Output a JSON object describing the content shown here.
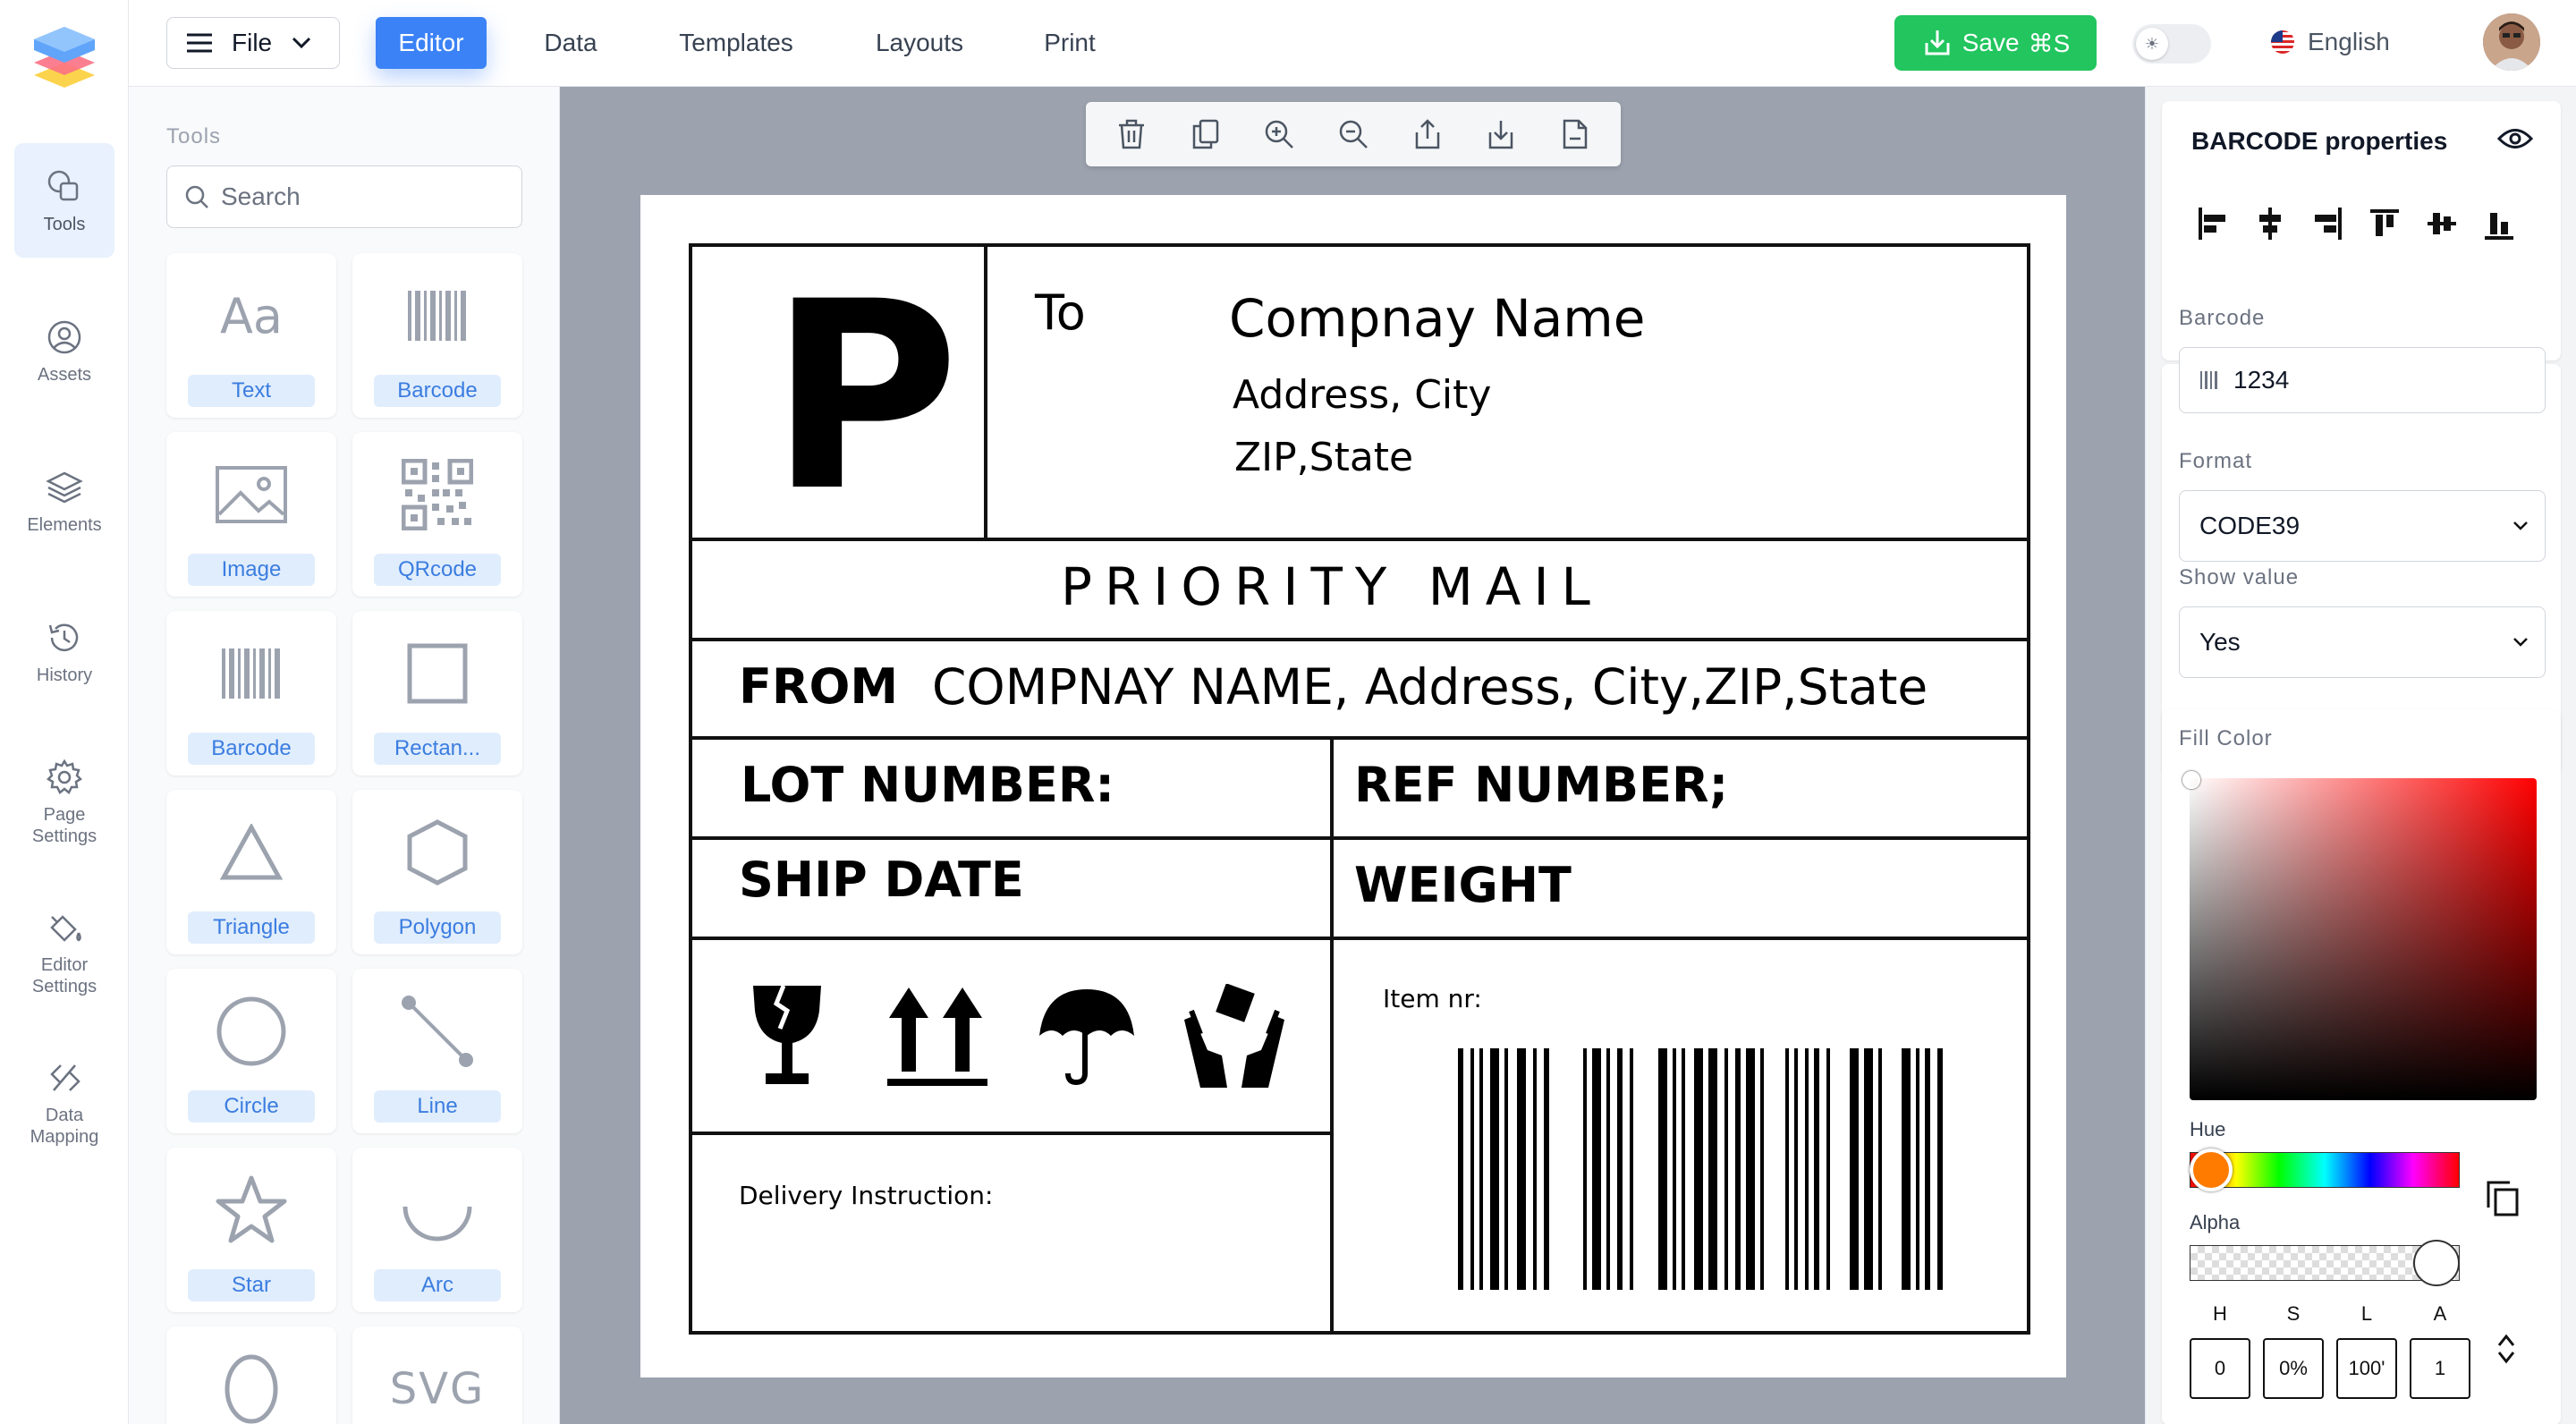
{
  "nav": {
    "items": [
      {
        "label": "Tools",
        "icon": "shapes-icon"
      },
      {
        "label": "Assets",
        "icon": "assets-icon"
      },
      {
        "label": "Elements",
        "icon": "layers-icon"
      },
      {
        "label": "History",
        "icon": "history-icon"
      },
      {
        "label": "Page Settings",
        "icon": "gear-icon"
      },
      {
        "label": "Editor Settings",
        "icon": "paint-bucket-icon"
      },
      {
        "label": "Data Mapping",
        "icon": "mapping-icon"
      }
    ]
  },
  "topbar": {
    "file_label": "File",
    "menu": [
      "Editor",
      "Data",
      "Templates",
      "Layouts",
      "Print"
    ],
    "active_menu": "Editor",
    "save_label": "Save",
    "save_shortcut": "⌘S",
    "language": "English",
    "colors": {
      "accent": "#3b82f6",
      "save": "#22c55e"
    }
  },
  "tools": {
    "title": "Tools",
    "search_placeholder": "Search",
    "items": [
      {
        "label": "Text",
        "icon": "text-icon"
      },
      {
        "label": "Barcode",
        "icon": "barcode-icon"
      },
      {
        "label": "Image",
        "icon": "image-icon"
      },
      {
        "label": "QRcode",
        "icon": "qrcode-icon"
      },
      {
        "label": "Barcode",
        "icon": "barcode-icon"
      },
      {
        "label": "Rectan...",
        "icon": "rectangle-icon"
      },
      {
        "label": "Triangle",
        "icon": "triangle-icon"
      },
      {
        "label": "Polygon",
        "icon": "hexagon-icon"
      },
      {
        "label": "Circle",
        "icon": "circle-icon"
      },
      {
        "label": "Line",
        "icon": "line-icon"
      },
      {
        "label": "Star",
        "icon": "star-icon"
      },
      {
        "label": "Arc",
        "icon": "arc-icon"
      },
      {
        "label": "",
        "icon": "ellipse-icon"
      },
      {
        "label": "",
        "icon": "svg-icon",
        "glyph": "SVG"
      }
    ]
  },
  "canvas_toolbar": [
    "trash-icon",
    "copy-icon",
    "zoom-in-icon",
    "zoom-out-icon",
    "upload-icon",
    "download-icon",
    "file-icon"
  ],
  "label": {
    "big_letter": "P",
    "to_label": "To",
    "company_name": "Compnay Name",
    "address_line": "Address, City",
    "zip_line": "ZIP,State",
    "priority": "PRIORITY MAIL",
    "from_label": "FROM",
    "from_value": "COMPNAY NAME, Address, City,ZIP,State",
    "lot_number": "LOT NUMBER:",
    "ref_number": "REF NUMBER;",
    "ship_date": "SHIP DATE",
    "weight": "WEIGHT",
    "item_nr": "Item nr:",
    "delivery_instruction": "Delivery Instruction:",
    "handling_icons": [
      "fragile-icon",
      "this-way-up-icon",
      "keep-dry-icon",
      "handle-with-care-icon"
    ]
  },
  "properties": {
    "title": "BARCODE properties",
    "barcode_label": "Barcode",
    "barcode_value": "1234",
    "format_label": "Format",
    "format_value": "CODE39",
    "show_value_label": "Show value",
    "show_value_value": "Yes",
    "fill_color_label": "Fill Color",
    "hue_label": "Hue",
    "alpha_label": "Alpha",
    "hsla_labels": [
      "H",
      "S",
      "L",
      "A"
    ],
    "hsla_values": [
      "0",
      "0%",
      "100'",
      "1"
    ]
  }
}
